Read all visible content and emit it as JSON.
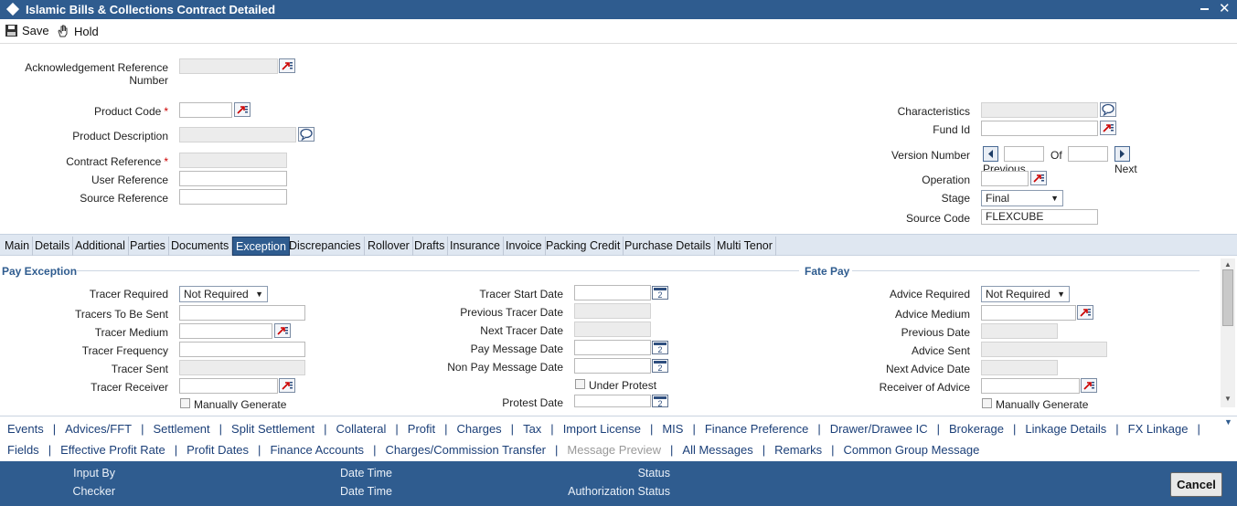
{
  "window": {
    "title": "Islamic Bills & Collections Contract Detailed",
    "close_glyph": "✕"
  },
  "toolbar": {
    "save_label": "Save",
    "hold_label": "Hold"
  },
  "header": {
    "ack_ref_label_1": "Acknowledgement Reference",
    "ack_ref_label_2": "Number",
    "product_code_label": "Product Code",
    "product_desc_label": "Product Description",
    "contract_ref_label": "Contract Reference",
    "user_ref_label": "User Reference",
    "source_ref_label": "Source Reference",
    "required_mark": "*",
    "characteristics_label": "Characteristics",
    "fund_id_label": "Fund Id",
    "version_number_label": "Version Number",
    "of_label": "Of",
    "previous_label": "Previous",
    "next_label": "Next",
    "operation_label": "Operation",
    "stage_label": "Stage",
    "stage_value": "Final",
    "source_code_label": "Source Code",
    "source_code_value": "FLEXCUBE"
  },
  "tabs": [
    "Main",
    "Details",
    "Additional",
    "Parties",
    "Documents",
    "Exception",
    "Discrepancies",
    "Rollover",
    "Drafts",
    "Insurance",
    "Invoice",
    "Packing Credit",
    "Purchase Details",
    "Multi Tenor"
  ],
  "active_tab": "Exception",
  "pay_exception": {
    "title": "Pay Exception",
    "tracer_required_label": "Tracer Required",
    "tracer_required_value": "Not Required",
    "tracers_to_be_sent_label": "Tracers To Be Sent",
    "tracer_medium_label": "Tracer Medium",
    "tracer_frequency_label": "Tracer Frequency",
    "tracer_sent_label": "Tracer Sent",
    "tracer_receiver_label": "Tracer Receiver",
    "manually_generate_label": "Manually Generate",
    "tracer_start_date_label": "Tracer Start Date",
    "previous_tracer_date_label": "Previous Tracer Date",
    "next_tracer_date_label": "Next Tracer Date",
    "pay_message_date_label": "Pay Message Date",
    "non_pay_message_date_label": "Non Pay Message Date",
    "under_protest_label": "Under Protest",
    "protest_date_label": "Protest Date"
  },
  "fate_pay": {
    "title": "Fate Pay",
    "advice_required_label": "Advice Required",
    "advice_required_value": "Not Required",
    "advice_medium_label": "Advice Medium",
    "previous_date_label": "Previous Date",
    "advice_sent_label": "Advice Sent",
    "next_advice_date_label": "Next Advice Date",
    "receiver_of_advice_label": "Receiver of Advice",
    "manually_generate_label": "Manually Generate"
  },
  "links_row1": [
    "Events",
    "Advices/FFT",
    "Settlement",
    "Split Settlement",
    "Collateral",
    "Profit",
    "Charges",
    "Tax",
    "Import License",
    "MIS",
    "Finance Preference",
    "Drawer/Drawee IC",
    "Brokerage",
    "Linkage Details",
    "FX Linkage"
  ],
  "links_row2": [
    "Fields",
    "Effective Profit Rate",
    "Profit Dates",
    "Finance Accounts",
    "Charges/Commission Transfer",
    "Message Preview",
    "All Messages",
    "Remarks",
    "Common Group Message"
  ],
  "footer": {
    "input_by_label": "Input By",
    "checker_label": "Checker",
    "date_time_label": "Date Time",
    "status_label": "Status",
    "authorization_status_label": "Authorization Status",
    "cancel_label": "Cancel"
  }
}
